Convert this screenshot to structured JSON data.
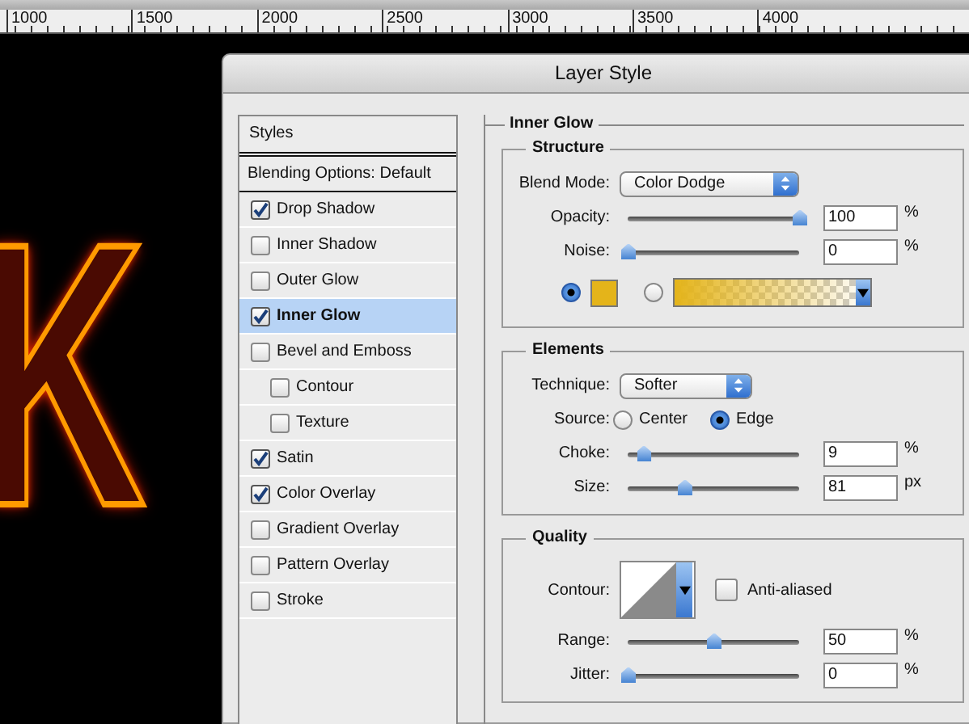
{
  "ruler": {
    "ticks": [
      "1000",
      "1500",
      "2000",
      "2500",
      "3000",
      "3500",
      "4000"
    ]
  },
  "canvas": {
    "letter": "K"
  },
  "dialog": {
    "title": "Layer Style",
    "styles": {
      "header": "Styles",
      "items": [
        {
          "kind": "option",
          "label": "Blending Options: Default",
          "selected": false
        },
        {
          "kind": "check",
          "label": "Drop Shadow",
          "checked": true,
          "selected": false
        },
        {
          "kind": "check",
          "label": "Inner Shadow",
          "checked": false,
          "selected": false
        },
        {
          "kind": "check",
          "label": "Outer Glow",
          "checked": false,
          "selected": false
        },
        {
          "kind": "check",
          "label": "Inner Glow",
          "checked": true,
          "selected": true
        },
        {
          "kind": "check",
          "label": "Bevel and Emboss",
          "checked": false,
          "selected": false,
          "children": [
            {
              "label": "Contour",
              "checked": false,
              "selected": false
            },
            {
              "label": "Texture",
              "checked": false,
              "selected": false
            }
          ]
        },
        {
          "kind": "check",
          "label": "Satin",
          "checked": true,
          "selected": false
        },
        {
          "kind": "check",
          "label": "Color Overlay",
          "checked": true,
          "selected": false
        },
        {
          "kind": "check",
          "label": "Gradient Overlay",
          "checked": false,
          "selected": false
        },
        {
          "kind": "check",
          "label": "Pattern Overlay",
          "checked": false,
          "selected": false
        },
        {
          "kind": "check",
          "label": "Stroke",
          "checked": false,
          "selected": false
        }
      ]
    },
    "panel": {
      "title": "Inner Glow",
      "sections": [
        {
          "title": "Structure",
          "rows": [
            {
              "kind": "select",
              "label": "Blend Mode:",
              "value": "Color Dodge"
            },
            {
              "kind": "slider",
              "label": "Opacity:",
              "level": 1,
              "value": "100",
              "unit": "%"
            },
            {
              "kind": "slider",
              "label": "Noise:",
              "level": 0,
              "value": "0",
              "unit": "%"
            },
            {
              "kind": "fill",
              "options": [
                {
                  "kind": "color",
                  "selected": true
                },
                {
                  "kind": "gradient",
                  "selected": false
                }
              ]
            }
          ]
        },
        {
          "title": "Elements",
          "rows": [
            {
              "kind": "select",
              "label": "Technique:",
              "value": "Softer"
            },
            {
              "kind": "radio",
              "label": "Source:",
              "options": [
                {
                  "label": "Center",
                  "selected": false
                },
                {
                  "label": "Edge",
                  "selected": true
                }
              ]
            },
            {
              "kind": "slider",
              "label": "Choke:",
              "level": 0.09,
              "value": "9",
              "unit": "%"
            },
            {
              "kind": "slider",
              "label": "Size:",
              "level": 0.33,
              "value": "81",
              "unit": "px"
            }
          ]
        },
        {
          "title": "Quality",
          "rows": [
            {
              "kind": "contour",
              "label": "Contour:",
              "checkbox": {
                "label": "Anti-aliased",
                "checked": false
              }
            },
            {
              "kind": "slider",
              "label": "Range:",
              "level": 0.5,
              "value": "50",
              "unit": "%"
            },
            {
              "kind": "slider",
              "label": "Jitter:",
              "level": 0,
              "value": "0",
              "unit": "%"
            }
          ]
        }
      ]
    }
  }
}
